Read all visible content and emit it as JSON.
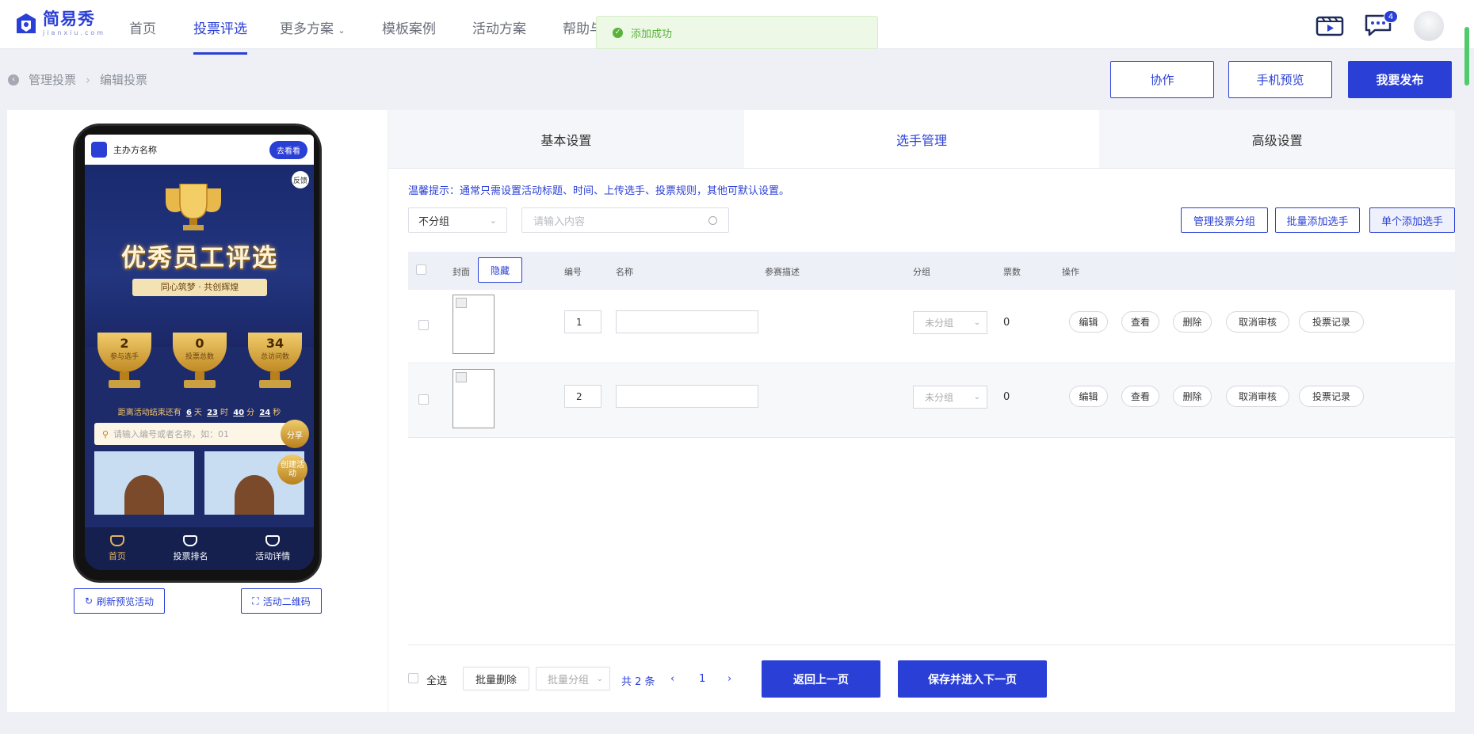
{
  "brand": {
    "name_cn": "简易秀",
    "name_en": "jianxiu.com",
    "accent": "#2a3fd6"
  },
  "nav": {
    "items": [
      "首页",
      "投票评选",
      "更多方案",
      "模板案例",
      "活动方案",
      "帮助与"
    ],
    "active": "投票评选"
  },
  "toast": {
    "text": "添加成功",
    "color": "#59b33a"
  },
  "header": {
    "message_badge": "4"
  },
  "breadcrumb": {
    "parent": "管理投票",
    "current": "编辑投票"
  },
  "top_buttons": {
    "collab": "协作",
    "mobile_preview": "手机预览",
    "publish": "我要发布"
  },
  "preview": {
    "org_name": "主办方名称",
    "go_look": "去看看",
    "feedback": "反馈",
    "title": "优秀员工评选",
    "subtitle": "同心筑梦 · 共创辉煌",
    "stats": [
      {
        "value": "2",
        "label": "参与选手"
      },
      {
        "value": "0",
        "label": "投票总数"
      },
      {
        "value": "34",
        "label": "总访问数"
      }
    ],
    "countdown": {
      "prefix": "距离活动结束还有",
      "days": "6",
      "d": "天",
      "hours": "23",
      "h": "时",
      "minutes": "40",
      "m": "分",
      "seconds": "24",
      "s": "秒"
    },
    "search_placeholder": "请输入编号或者名称，如：01",
    "share": "分享",
    "create": "创建活动",
    "tabbar": [
      "首页",
      "投票排名",
      "活动详情"
    ],
    "refresh_btn": "刷新预览活动",
    "qrcode_btn": "活动二维码"
  },
  "tabs": [
    "基本设置",
    "选手管理",
    "高级设置"
  ],
  "active_tab": "选手管理",
  "tip": "温馨提示：通常只需设置活动标题、时间、上传选手、投票规则，其他可默认设置。",
  "filter": {
    "group_value": "不分组",
    "search_placeholder": "请输入内容"
  },
  "action_buttons": {
    "manage_groups": "管理投票分组",
    "batch_add": "批量添加选手",
    "single_add": "单个添加选手"
  },
  "table": {
    "headers": {
      "cover": "封面",
      "hide": "隐藏",
      "number": "编号",
      "name": "名称",
      "desc": "参赛描述",
      "group": "分组",
      "votes": "票数",
      "ops": "操作"
    },
    "rows": [
      {
        "number": "1",
        "name": "",
        "group": "未分组",
        "votes": "0"
      },
      {
        "number": "2",
        "name": "",
        "group": "未分组",
        "votes": "0"
      }
    ],
    "row_actions": [
      "编辑",
      "查看",
      "删除",
      "取消审核",
      "投票记录"
    ]
  },
  "footer": {
    "select_all": "全选",
    "batch_delete": "批量删除",
    "batch_group": "批量分组",
    "total": "共 2 条",
    "page": "1",
    "prev_step": "返回上一页",
    "save_next": "保存并进入下一页"
  }
}
